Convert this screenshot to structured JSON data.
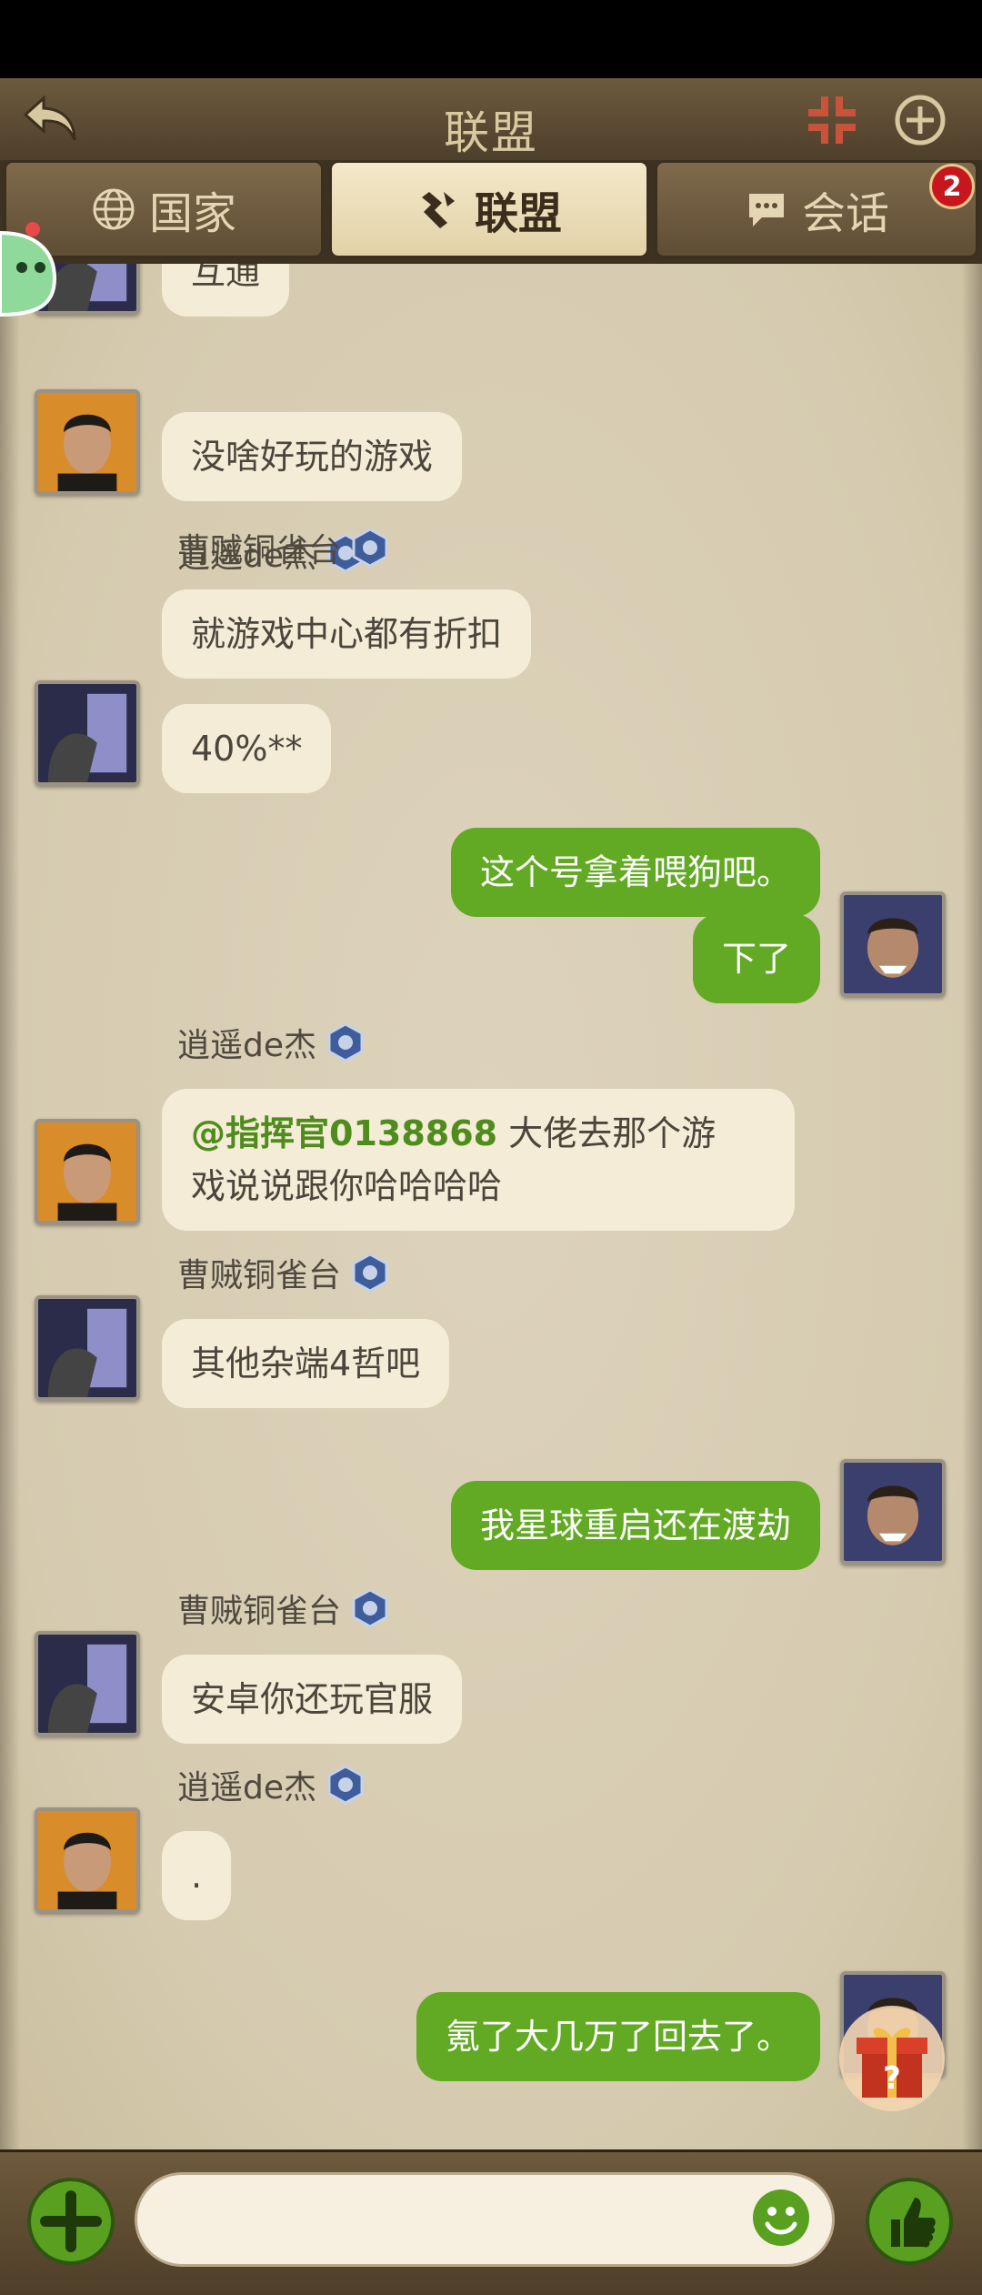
{
  "header": {
    "title": "联盟"
  },
  "tabs": [
    {
      "label": "国家"
    },
    {
      "label": "联盟"
    },
    {
      "label": "会话"
    }
  ],
  "badge": {
    "count": "2"
  },
  "messages": {
    "m0": {
      "text": "互通"
    },
    "m1": {
      "name": "逍遥de杰",
      "text": "没啥好玩的游戏"
    },
    "m2": {
      "name": "曹贼铜雀台",
      "text1": "就游戏中心都有折扣",
      "text2": "40%**"
    },
    "m3": {
      "text1": "这个号拿着喂狗吧。",
      "text2": "下了"
    },
    "m4": {
      "name": "逍遥de杰",
      "mention": "@指挥官0138868",
      "text1": " 大佬去那个游",
      "text2": "戏说说跟你哈哈哈哈"
    },
    "m5": {
      "name": "曹贼铜雀台",
      "text": "其他杂端4哲吧"
    },
    "m6": {
      "text": "我星球重启还在渡劫"
    },
    "m7": {
      "name": "曹贼铜雀台",
      "text": "安卓你还玩官服"
    },
    "m8": {
      "name": "逍遥de杰",
      "text": "."
    },
    "m9": {
      "text": "氪了大几万了回去了。"
    }
  },
  "colors": {
    "out_bubble": "#62a924",
    "in_bubble": "#f4ecd7",
    "header": "#5e4c33",
    "badge": "#c8161f"
  },
  "icons": {
    "back": "back-arrow-icon",
    "shrink": "shrink-icon",
    "add": "plus-circle-icon",
    "globe": "globe-icon",
    "alliance": "alliance-icon",
    "chat": "chat-bubble-icon",
    "rank": "rank-badge-icon",
    "gift": "gift-icon",
    "emoji": "emoji-icon",
    "like": "thumbs-up-icon"
  }
}
